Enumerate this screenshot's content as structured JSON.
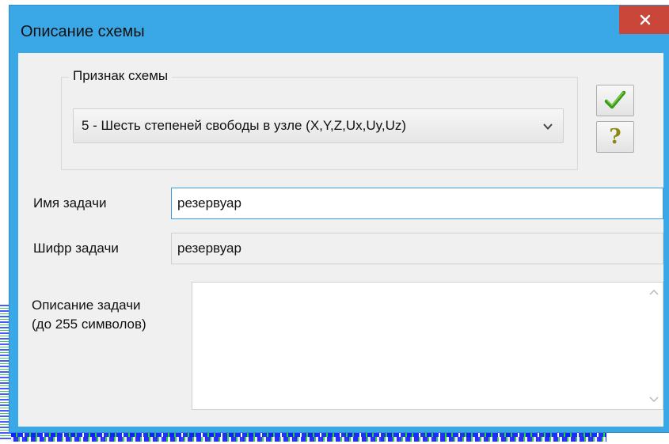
{
  "window": {
    "title": "Описание схемы",
    "close_label": "×"
  },
  "scheme_group": {
    "legend": "Признак схемы",
    "selected_option": "5 - Шесть степеней свободы в узле (X,Y,Z,Ux,Uy,Uz)"
  },
  "buttons": {
    "ok_icon": "checkmark-icon",
    "help_label": "?"
  },
  "task_name": {
    "label": "Имя задачи",
    "value": "резервуар"
  },
  "task_code": {
    "label": "Шифр задачи",
    "value": "резервуар"
  },
  "task_description": {
    "label_line1": "Описание задачи",
    "label_line2": "(до 255 символов)",
    "value": ""
  },
  "colors": {
    "title_bar": "#3aa7e6",
    "close_button": "#c94638",
    "client_bg": "#f0f0f0",
    "focus_border": "#3c9be0",
    "checkmark": "#3a9a1a",
    "help_glyph": "#8a8a10"
  }
}
